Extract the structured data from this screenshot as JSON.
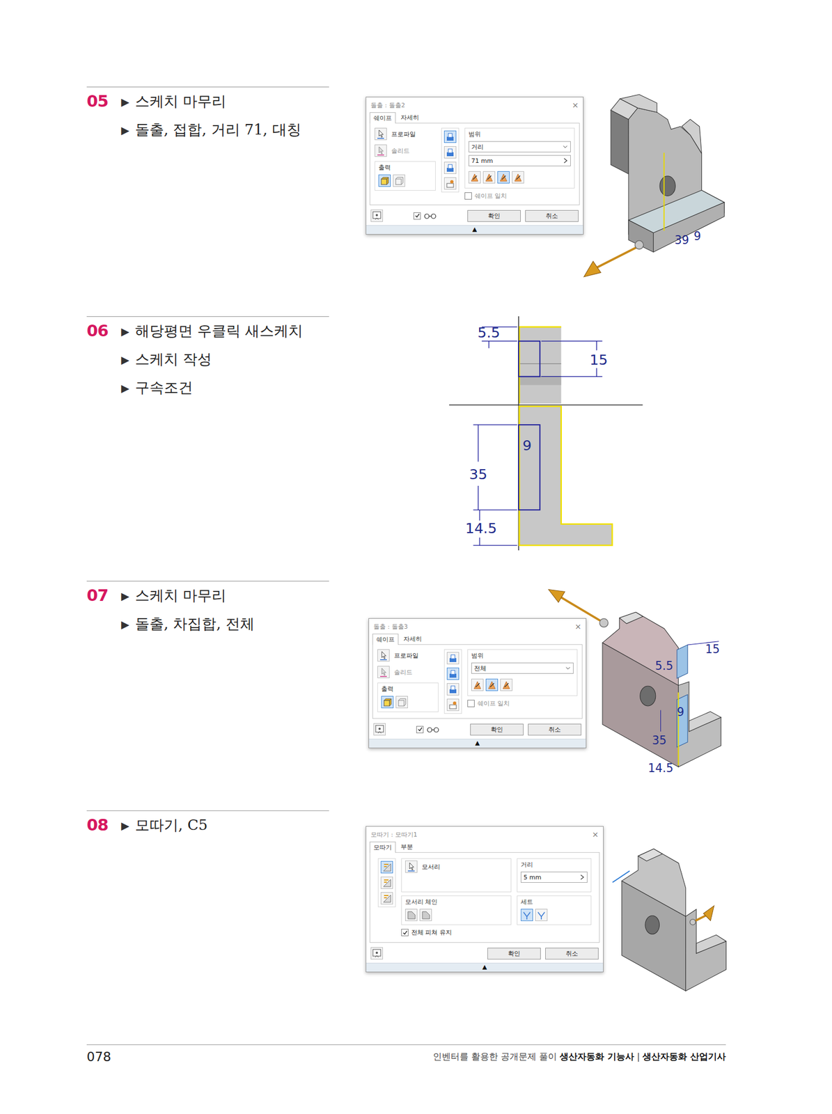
{
  "bullet": "▶",
  "sections": [
    {
      "number": "05",
      "steps": [
        "스케치 마무리",
        "돌출, 접합, 거리 71, 대칭"
      ],
      "dialog": {
        "kind": "extrude",
        "title": "돌출 : 돌출2",
        "close": "×",
        "tabs": [
          {
            "label": "쉐이프",
            "selected": true
          },
          {
            "label": "자세히",
            "selected": false
          }
        ],
        "profile": "프로파일",
        "solid": "솔리드",
        "output": {
          "label": "출력",
          "buttons": [
            {
              "selected": true
            },
            {
              "selected": false
            }
          ]
        },
        "operations": [
          {
            "selected": true
          },
          {
            "selected": false
          },
          {
            "selected": false
          },
          {
            "selected": false
          }
        ],
        "range": {
          "label": "범위",
          "value": "거리",
          "distance": "71 mm"
        },
        "directions": [
          {
            "selected": false
          },
          {
            "selected": false
          },
          {
            "selected": true
          },
          {
            "selected": false
          }
        ],
        "match": {
          "label": "쉐이프 일치",
          "checked": false
        },
        "preview": {
          "checked": true
        },
        "buttons": [
          "확인",
          "취소"
        ],
        "expand": "▲"
      },
      "figure": {
        "kind": "model-extrude",
        "labels": [
          "39",
          "9"
        ]
      }
    },
    {
      "number": "06",
      "steps": [
        "해당평면 우클릭 새스케치",
        "스케치 작성",
        "구속조건"
      ],
      "figure": {
        "kind": "sketch",
        "labels": [
          "5.5",
          "15",
          "9",
          "35",
          "14.5"
        ]
      }
    },
    {
      "number": "07",
      "steps": [
        "스케치 마무리",
        "돌출, 차집합, 전체"
      ],
      "dialog": {
        "kind": "extrude",
        "title": "돌출 : 돌출3",
        "close": "×",
        "tabs": [
          {
            "label": "쉐이프",
            "selected": true
          },
          {
            "label": "자세히",
            "selected": false
          }
        ],
        "profile": "프로파일",
        "solid": "솔리드",
        "output": {
          "label": "출력",
          "buttons": [
            {
              "selected": true
            },
            {
              "selected": false
            }
          ]
        },
        "operations": [
          {
            "selected": false
          },
          {
            "selected": true
          },
          {
            "selected": false
          },
          {
            "selected": false
          }
        ],
        "range": {
          "label": "범위",
          "value": "전체"
        },
        "directions": [
          {
            "selected": false
          },
          {
            "selected": true
          },
          {
            "selected": false
          }
        ],
        "match": {
          "label": "쉐이프 일치",
          "checked": false
        },
        "preview": {
          "checked": true
        },
        "buttons": [
          "확인",
          "취소"
        ],
        "expand": "▲"
      },
      "figure": {
        "kind": "model-cut",
        "labels": [
          "15",
          "5.5",
          "9",
          "35",
          "14.5"
        ]
      }
    },
    {
      "number": "08",
      "steps": [
        "모따기, C5"
      ],
      "dialog": {
        "kind": "chamfer",
        "title": "모따기 : 모따기1",
        "close": "×",
        "tabs": [
          {
            "label": "모따기",
            "selected": true
          },
          {
            "label": "부분",
            "selected": false
          }
        ],
        "methods": [
          {
            "selected": true
          },
          {
            "selected": false
          },
          {
            "selected": false
          }
        ],
        "edges": {
          "label": "모서리"
        },
        "distance": {
          "label": "거리",
          "value": "5 mm"
        },
        "chain": {
          "label": "모서리 체인",
          "buttons": [
            {
              "selected": false
            },
            {
              "selected": false
            }
          ]
        },
        "setback": {
          "label": "세트",
          "buttons": [
            {
              "selected": true
            },
            {
              "selected": false
            }
          ]
        },
        "keep": {
          "label": "전체 피쳐 유지",
          "checked": true
        },
        "buttons": [
          "확인",
          "취소"
        ],
        "expand": "▲"
      },
      "figure": {
        "kind": "model-chamfer",
        "labels": []
      }
    }
  ],
  "footer": {
    "page": "078",
    "parts": [
      {
        "text": "인벤터를 활용한 공개문제 풀이 ",
        "bold": false
      },
      {
        "text": "생산자동화 기능사",
        "bold": true
      },
      {
        "text": " | ",
        "bold": false
      },
      {
        "text": "생산자동화 산업기사",
        "bold": true
      }
    ]
  }
}
